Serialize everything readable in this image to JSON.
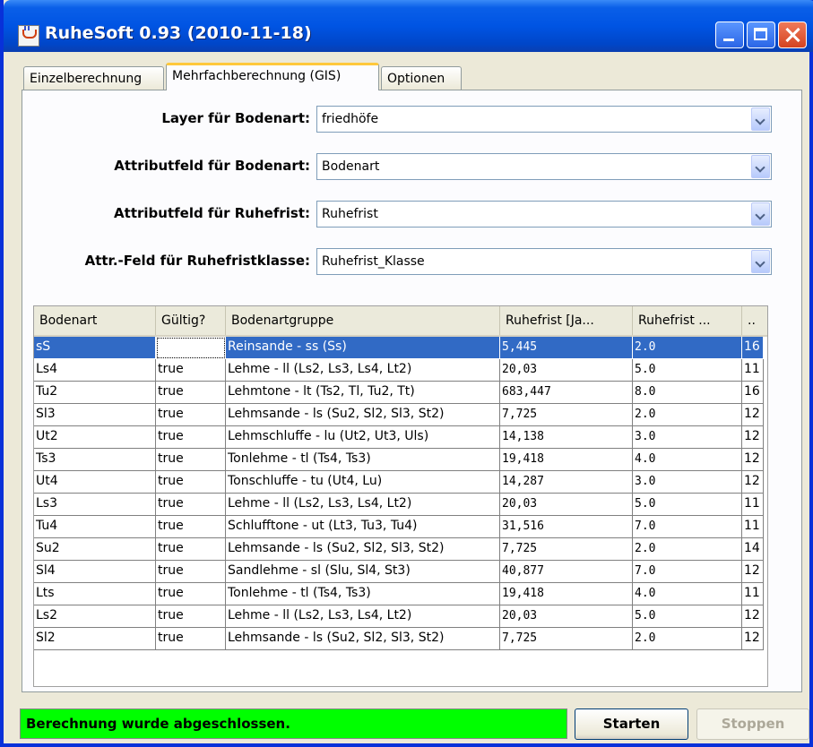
{
  "window": {
    "title": "RuheSoft 0.93 (2010-11-18)"
  },
  "tabs": [
    {
      "label": "Einzelberechnung"
    },
    {
      "label": "Mehrfachberechnung (GIS)"
    },
    {
      "label": "Optionen"
    }
  ],
  "form": {
    "layer_label": "Layer für Bodenart:",
    "layer_value": "friedhöfe",
    "soil_field_label": "Attributfeld für Bodenart:",
    "soil_field_value": "Bodenart",
    "rest_field_label": "Attributfeld für Ruhefrist:",
    "rest_field_value": "Ruhefrist",
    "rest_class_label": "Attr.-Feld für Ruhefristklasse:",
    "rest_class_value": "Ruhefrist_Klasse"
  },
  "table": {
    "columns": [
      "Bodenart",
      "Gültig?",
      "Bodenartgruppe",
      "Ruhefrist [Ja...",
      "Ruhefrist ...",
      ".."
    ],
    "rows": [
      [
        "sS",
        "",
        "Reinsande - ss (Ss)",
        "5,445",
        "2.0",
        "16"
      ],
      [
        "Ls4",
        "true",
        "Lehme - ll (Ls2, Ls3, Ls4, Lt2)",
        "20,03",
        "5.0",
        "11"
      ],
      [
        "Tu2",
        "true",
        "Lehmtone - lt (Ts2, Tl, Tu2, Tt)",
        "683,447",
        "8.0",
        "16"
      ],
      [
        "Sl3",
        "true",
        "Lehmsande - ls (Su2, Sl2, Sl3, St2)",
        "7,725",
        "2.0",
        "12"
      ],
      [
        "Ut2",
        "true",
        "Lehmschluffe - lu (Ut2, Ut3, Uls)",
        "14,138",
        "3.0",
        "12"
      ],
      [
        "Ts3",
        "true",
        "Tonlehme - tl (Ts4, Ts3)",
        "19,418",
        "4.0",
        "12"
      ],
      [
        "Ut4",
        "true",
        "Tonschluffe - tu (Ut4, Lu)",
        "14,287",
        "3.0",
        "12"
      ],
      [
        "Ls3",
        "true",
        "Lehme - ll (Ls2, Ls3, Ls4, Lt2)",
        "20,03",
        "5.0",
        "11"
      ],
      [
        "Tu4",
        "true",
        "Schlufftone - ut (Lt3, Tu3, Tu4)",
        "31,516",
        "7.0",
        "11"
      ],
      [
        "Su2",
        "true",
        "Lehmsande - ls (Su2, Sl2, Sl3, St2)",
        "7,725",
        "2.0",
        "14"
      ],
      [
        "Sl4",
        "true",
        "Sandlehme - sl (Slu, Sl4, St3)",
        "40,877",
        "7.0",
        "12"
      ],
      [
        "Lts",
        "true",
        "Tonlehme - tl (Ts4, Ts3)",
        "19,418",
        "4.0",
        "11"
      ],
      [
        "Ls2",
        "true",
        "Lehme - ll (Ls2, Ls3, Ls4, Lt2)",
        "20,03",
        "5.0",
        "12"
      ],
      [
        "Sl2",
        "true",
        "Lehmsande - ls (Su2, Sl2, Sl3, St2)",
        "7,725",
        "2.0",
        "12"
      ]
    ]
  },
  "status": {
    "text": "Berechnung wurde abgeschlossen.",
    "color": "#00ff00"
  },
  "buttons": {
    "start": "Starten",
    "stop": "Stoppen"
  },
  "colors": {
    "selection": "#316ac5",
    "title_bar": "#0054e3"
  }
}
